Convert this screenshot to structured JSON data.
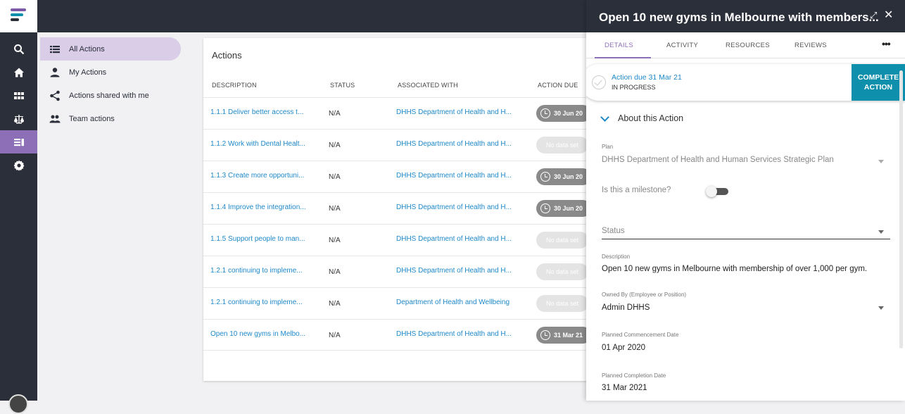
{
  "subnav": {
    "items": [
      {
        "label": "All Actions",
        "icon": "list-icon",
        "active": true
      },
      {
        "label": "My Actions",
        "icon": "person-icon"
      },
      {
        "label": "Actions shared with me",
        "icon": "share-icon"
      },
      {
        "label": "Team actions",
        "icon": "group-icon"
      }
    ]
  },
  "rail": {
    "icons": [
      "search-icon",
      "home-icon",
      "dashboard-icon",
      "scales-icon",
      "actions-icon",
      "settings-icon"
    ],
    "logo_colors": [
      "#7a5aa6",
      "#0e8fac",
      "#2b2f3a"
    ]
  },
  "actions": {
    "title": "Actions",
    "columns": {
      "description": "DESCRIPTION",
      "status": "STATUS",
      "associated": "ASSOCIATED WITH",
      "due": "ACTION DUE"
    },
    "rows": [
      {
        "description": "1.1.1 Deliver better access t...",
        "status": "N/A",
        "associated": "DHHS Department of Health and H...",
        "due": "30 Jun 20"
      },
      {
        "description": "1.1.2 Work with Dental Healt...",
        "status": "N/A",
        "associated": "DHHS Department of Health and H...",
        "due": "No data set"
      },
      {
        "description": "1.1.3 Create more opportuni...",
        "status": "N/A",
        "associated": "DHHS Department of Health and H...",
        "due": "30 Jun 20"
      },
      {
        "description": "1.1.4 Improve the integration...",
        "status": "N/A",
        "associated": "DHHS Department of Health and H...",
        "due": "30 Jun 20"
      },
      {
        "description": "1.1.5 Support people to man...",
        "status": "N/A",
        "associated": "DHHS Department of Health and H...",
        "due": "No data set"
      },
      {
        "description": "1.2.1 continuing to impleme...",
        "status": "N/A",
        "associated": "DHHS Department of Health and H...",
        "due": "No data set"
      },
      {
        "description": "1.2.1 continuing to impleme...",
        "status": "N/A",
        "associated": "Department of Health and Wellbeing",
        "due": "No data set"
      },
      {
        "description": "Open 10 new gyms in Melbo...",
        "status": "N/A",
        "associated": "DHHS Department of Health and H...",
        "due": "31 Mar 21"
      }
    ]
  },
  "panel": {
    "title": "Open 10 new gyms in Melbourne with members...",
    "expand_icon": "⤢",
    "close_icon": "✕",
    "tabs": [
      "DETAILS",
      "ACTIVITY",
      "RESOURCES",
      "REVIEWS"
    ],
    "more_icon": "•••",
    "due_label": "Action due 31 Mar 21",
    "due_status": "IN PROGRESS",
    "complete_label_1": "COMPLETE",
    "complete_label_2": "ACTION",
    "section_title": "About this Action",
    "plan_label": "Plan",
    "plan_value": "DHHS Department of Health and Human Services Strategic Plan",
    "milestone_label": "Is this a milestone?",
    "status_placeholder": "Status",
    "description_label": "Description",
    "description_value": "Open 10 new gyms in Melbourne with membership of over 1,000 per gym.",
    "owned_label": "Owned By (Employee or Position)",
    "owned_value": "Admin DHHS",
    "commencement_label": "Planned Commencement Date",
    "commencement_value": "01 Apr 2020",
    "completion_label": "Planned Completion Date",
    "completion_value": "31 Mar 2021"
  }
}
